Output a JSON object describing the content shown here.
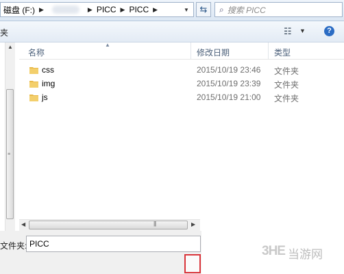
{
  "address_bar": {
    "crumbs": [
      "磁盘 (F:)",
      "PICC",
      "PICC"
    ]
  },
  "search": {
    "placeholder": "搜索 PICC"
  },
  "toolbar": {
    "partial_label": "夹"
  },
  "columns": {
    "name": "名称",
    "date": "修改日期",
    "type": "类型"
  },
  "files": [
    {
      "name": "css",
      "date": "2015/10/19 23:46",
      "type": "文件夹"
    },
    {
      "name": "img",
      "date": "2015/10/19 23:39",
      "type": "文件夹"
    },
    {
      "name": "js",
      "date": "2015/10/19 21:00",
      "type": "文件夹"
    }
  ],
  "bottom": {
    "folder_label": "文件夹:",
    "folder_value": "PICC"
  },
  "watermark": {
    "logo": "3HE",
    "text": "当游网"
  },
  "colors": {
    "folder": "#e8b94a",
    "highlight": "#d9343a",
    "accent": "#2b6cc4"
  },
  "icons": [
    "folder-icon",
    "search-icon",
    "refresh-icon",
    "views-icon",
    "help-icon"
  ]
}
